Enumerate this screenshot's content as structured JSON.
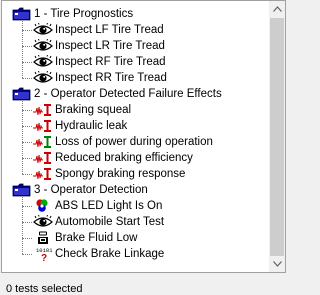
{
  "tree": {
    "groups": [
      {
        "label": "1 - Tire Prognostics",
        "icon": "folder-icon",
        "children": [
          {
            "label": "Inspect LF Tire Tread",
            "icon": "eye-icon"
          },
          {
            "label": "Inspect LR Tire Tread",
            "icon": "eye-icon"
          },
          {
            "label": "Inspect RF Tire Tread",
            "icon": "eye-icon"
          },
          {
            "label": "Inspect RR Tire Tread",
            "icon": "eye-icon"
          }
        ]
      },
      {
        "label": "2 - Operator Detected Failure Effects",
        "icon": "folder-icon",
        "children": [
          {
            "label": "Braking squeal",
            "icon": "waveform-alert-icon"
          },
          {
            "label": "Hydraulic leak",
            "icon": "waveform-alert-icon"
          },
          {
            "label": "Loss of power during operation",
            "icon": "waveform-ok-icon"
          },
          {
            "label": "Reduced braking efficiency",
            "icon": "waveform-alert-icon"
          },
          {
            "label": "Spongy braking response",
            "icon": "waveform-alert-icon"
          }
        ]
      },
      {
        "label": "3 - Operator Detection",
        "icon": "folder-icon",
        "children": [
          {
            "label": "ABS LED Light Is On",
            "icon": "color-dots-icon"
          },
          {
            "label": "Automobile Start Test",
            "icon": "eye-icon"
          },
          {
            "label": "Brake Fluid Low",
            "icon": "hand-icon"
          },
          {
            "label": "Check Brake Linkage",
            "icon": "binary-question-icon"
          }
        ]
      }
    ]
  },
  "colors": {
    "folder": "#000080",
    "alert": "#cc0000",
    "ok": "#008000"
  },
  "status": {
    "text": "0 tests selected"
  }
}
